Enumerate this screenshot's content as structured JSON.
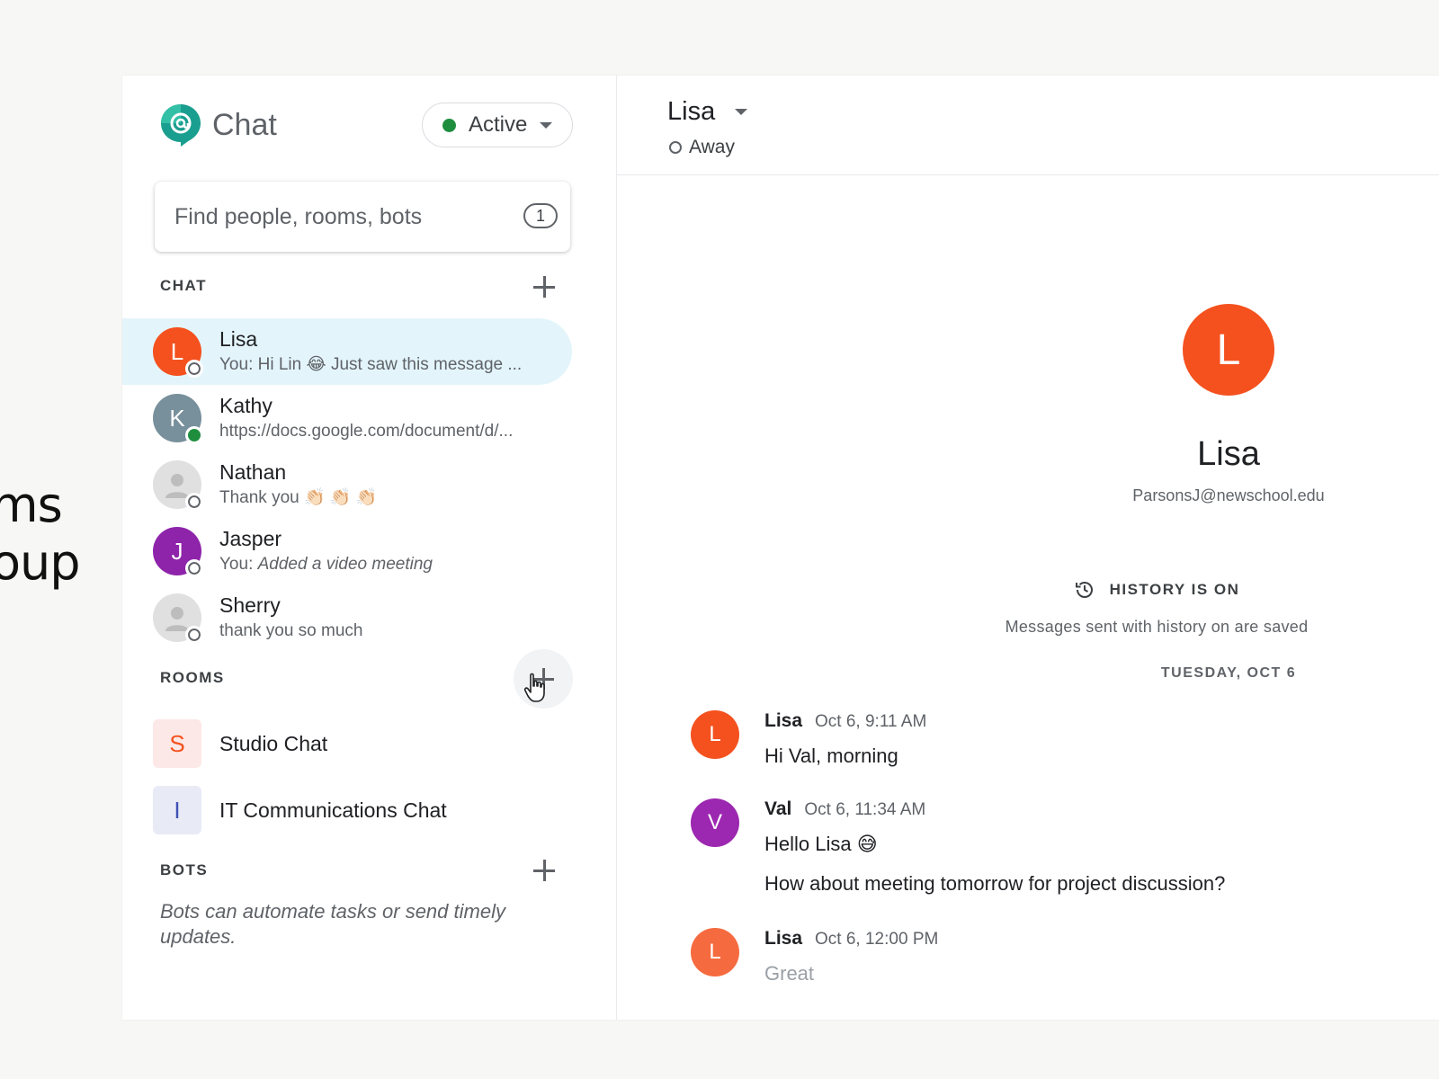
{
  "background_caption": [
    "ms",
    "oup"
  ],
  "sidebar": {
    "brand": "Chat",
    "status": {
      "label": "Active",
      "color": "#1e8e3e"
    },
    "search": {
      "placeholder": "Find people, rooms, bots",
      "badge": "1"
    },
    "chat_header": "CHAT",
    "chats": [
      {
        "name": "Lisa",
        "initial": "L",
        "avatar_color": "#f4511e",
        "presence": "away",
        "preview": "You: Hi Lin 😂 Just saw this message ...",
        "selected": true
      },
      {
        "name": "Kathy",
        "initial": "K",
        "avatar_color": "#78909c",
        "presence": "active",
        "preview": "https://docs.google.com/document/d/...",
        "selected": false
      },
      {
        "name": "Nathan",
        "initial": "",
        "avatar_color": "#e0e0e0",
        "presence": "away",
        "preview": "Thank you 👏🏻 👏🏻 👏🏻",
        "selected": false
      },
      {
        "name": "Jasper",
        "initial": "J",
        "avatar_color": "#8e24aa",
        "presence": "away",
        "preview_prefix": "You: ",
        "preview_italic": "Added a video meeting",
        "selected": false
      },
      {
        "name": "Sherry",
        "initial": "",
        "avatar_color": "#e0e0e0",
        "presence": "away",
        "preview": "thank you so much",
        "selected": false
      }
    ],
    "rooms_header": "ROOMS",
    "rooms": [
      {
        "name": "Studio Chat",
        "initial": "S",
        "tile_bg": "#fce8e6",
        "tile_fg": "#f4511e"
      },
      {
        "name": "IT Communications Chat",
        "initial": "I",
        "tile_bg": "#e8eaf6",
        "tile_fg": "#3f51b5"
      }
    ],
    "bots_header": "BOTS",
    "bots_note": "Bots can automate tasks or send timely updates."
  },
  "conversation": {
    "name": "Lisa",
    "status": "Away",
    "profile": {
      "initial": "L",
      "name": "Lisa",
      "email": "ParsonsJ@newschool.edu",
      "avatar_color": "#f4511e"
    },
    "history": {
      "heading": "HISTORY IS ON",
      "note": "Messages sent with history on are saved"
    },
    "date_separator": "TUESDAY, OCT 6",
    "messages": [
      {
        "initial": "L",
        "sender": "Lisa",
        "time": "Oct 6, 9:11 AM",
        "avatar_color": "#f4511e",
        "lines": [
          "Hi Val, morning"
        ]
      },
      {
        "initial": "V",
        "sender": "Val",
        "time": "Oct 6, 11:34 AM",
        "avatar_color": "#9c27b0",
        "lines": [
          "Hello Lisa 😅",
          "How about meeting tomorrow for project discussion?"
        ]
      },
      {
        "initial": "L",
        "sender": "Lisa",
        "time": "Oct 6, 12:00 PM",
        "avatar_color": "#f4511e",
        "lines": [
          "Great"
        ]
      }
    ]
  },
  "icons": {
    "brand": "google-chat-logo-icon",
    "add": "plus-icon",
    "history": "history-clock-icon",
    "cursor": "hand-pointer-icon",
    "placeholder_avatar": "person-silhouette-icon"
  }
}
